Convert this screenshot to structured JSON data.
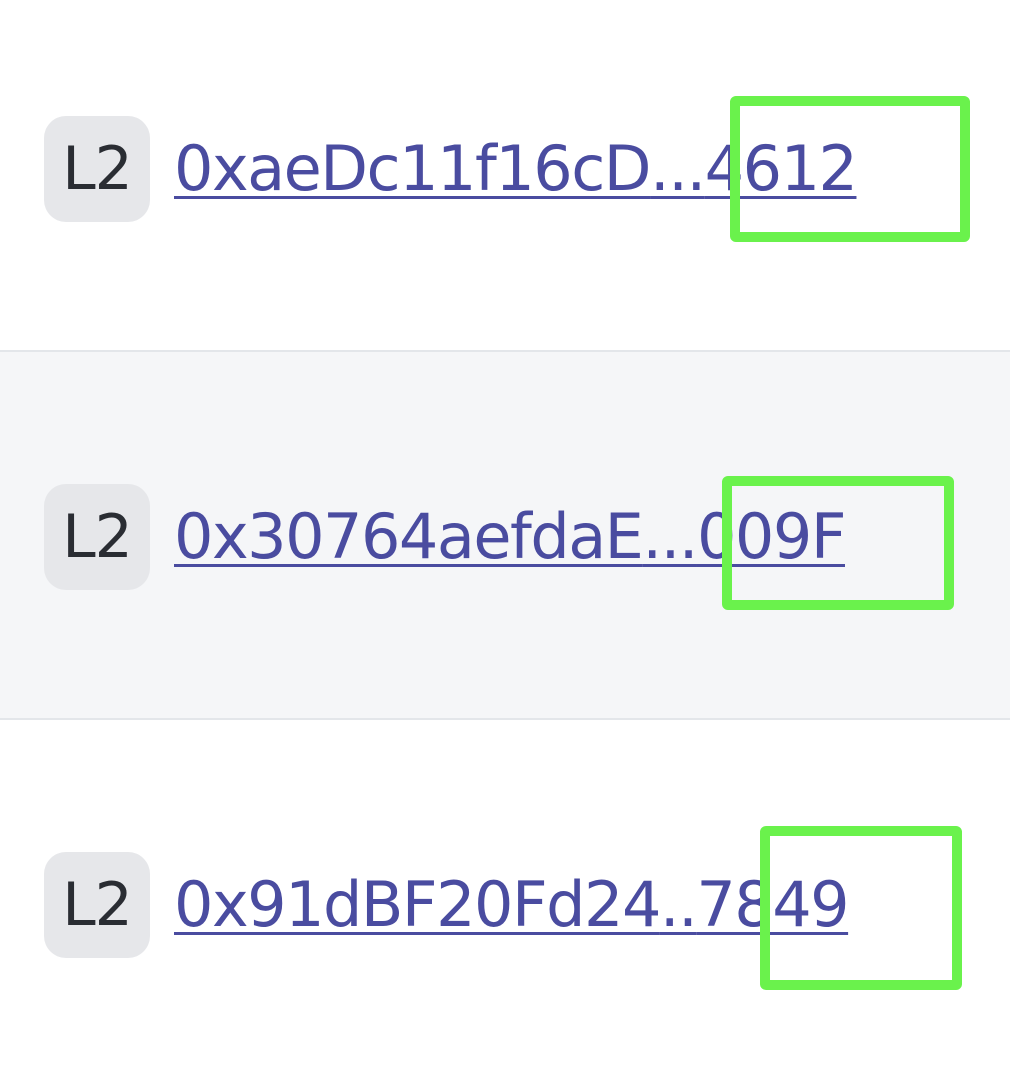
{
  "rows": [
    {
      "layer_badge": "L2",
      "address_prefix": "0xaeDc11f16cD",
      "ellipsis": "...",
      "address_suffix": "4612"
    },
    {
      "layer_badge": "L2",
      "address_prefix": "0x30764aefdaE",
      "ellipsis": "...",
      "address_suffix": "009F"
    },
    {
      "layer_badge": "L2",
      "address_prefix": "0x91dBF20Fd24",
      "ellipsis": "..",
      "address_suffix": "7849"
    }
  ],
  "colors": {
    "link": "#4a4ca0",
    "badge_bg": "#e6e7ea",
    "highlight": "#6af24c",
    "row_alt_bg": "#f5f6f8",
    "divider": "#e3e6ea"
  }
}
